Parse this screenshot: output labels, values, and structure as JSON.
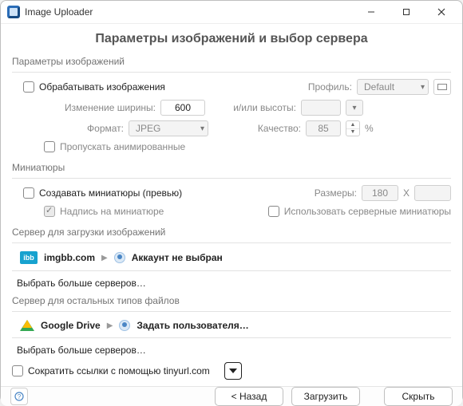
{
  "titlebar": {
    "app_title": "Image Uploader"
  },
  "heading": "Параметры изображений и выбор сервера",
  "params": {
    "group_title": "Параметры изображений",
    "process_images_label": "Обрабатывать изображения",
    "profile_label": "Профиль:",
    "profile_value": "Default",
    "resize_width_label": "Изменение ширины:",
    "resize_width_value": "600",
    "height_label": "и/или высоты:",
    "height_value": "",
    "format_label": "Формат:",
    "format_value": "JPEG",
    "quality_label": "Качество:",
    "quality_value": "85",
    "quality_unit": "%",
    "skip_animated_label": "Пропускать анимированные"
  },
  "thumbs": {
    "group_title": "Миниатюры",
    "create_label": "Создавать миниатюры (превью)",
    "size_label": "Размеры:",
    "width_value": "180",
    "x_label": "X",
    "caption_label": "Надпись на миниатюре",
    "server_thumbs_label": "Использовать серверные миниатюры"
  },
  "image_server": {
    "group_title": "Сервер для загрузки изображений",
    "server_badge": "ibb",
    "server_name": "imgbb.com",
    "account_label": "Аккаунт не выбран",
    "more_label": "Выбрать больше серверов…"
  },
  "file_server": {
    "group_title": "Сервер для остальных типов файлов",
    "server_name": "Google Drive",
    "account_label": "Задать пользователя…",
    "more_label": "Выбрать больше серверов…"
  },
  "shorten": {
    "label": "Сократить ссылки с помощью tinyurl.com"
  },
  "footer": {
    "back_label": "< Назад",
    "upload_label": "Загрузить",
    "hide_label": "Скрыть"
  }
}
